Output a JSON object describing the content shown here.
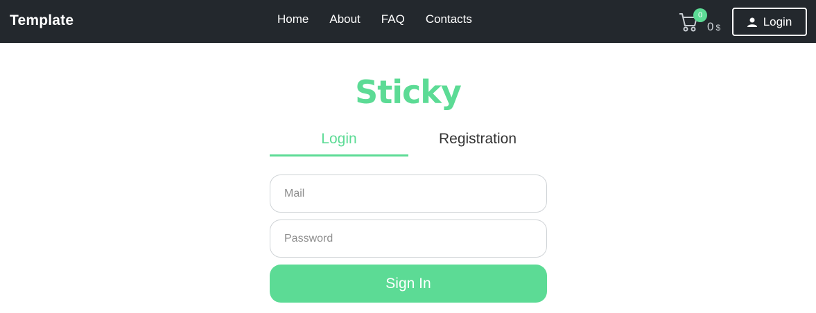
{
  "header": {
    "brand": "Template",
    "nav": [
      "Home",
      "About",
      "FAQ",
      "Contacts"
    ],
    "cart": {
      "icon": "cart-icon",
      "badge_count": "0",
      "total": "0",
      "currency": "$"
    },
    "login_button": {
      "icon": "user-icon",
      "label": "Login"
    }
  },
  "main": {
    "logo_text": "Sticky",
    "tabs": [
      {
        "label": "Login",
        "active": true
      },
      {
        "label": "Registration",
        "active": false
      }
    ],
    "form": {
      "mail_placeholder": "Mail",
      "password_placeholder": "Password",
      "submit_label": "Sign In"
    }
  },
  "colors": {
    "topbar": "#23282d",
    "accent": "#5cdb95",
    "text_dark": "#333333"
  }
}
